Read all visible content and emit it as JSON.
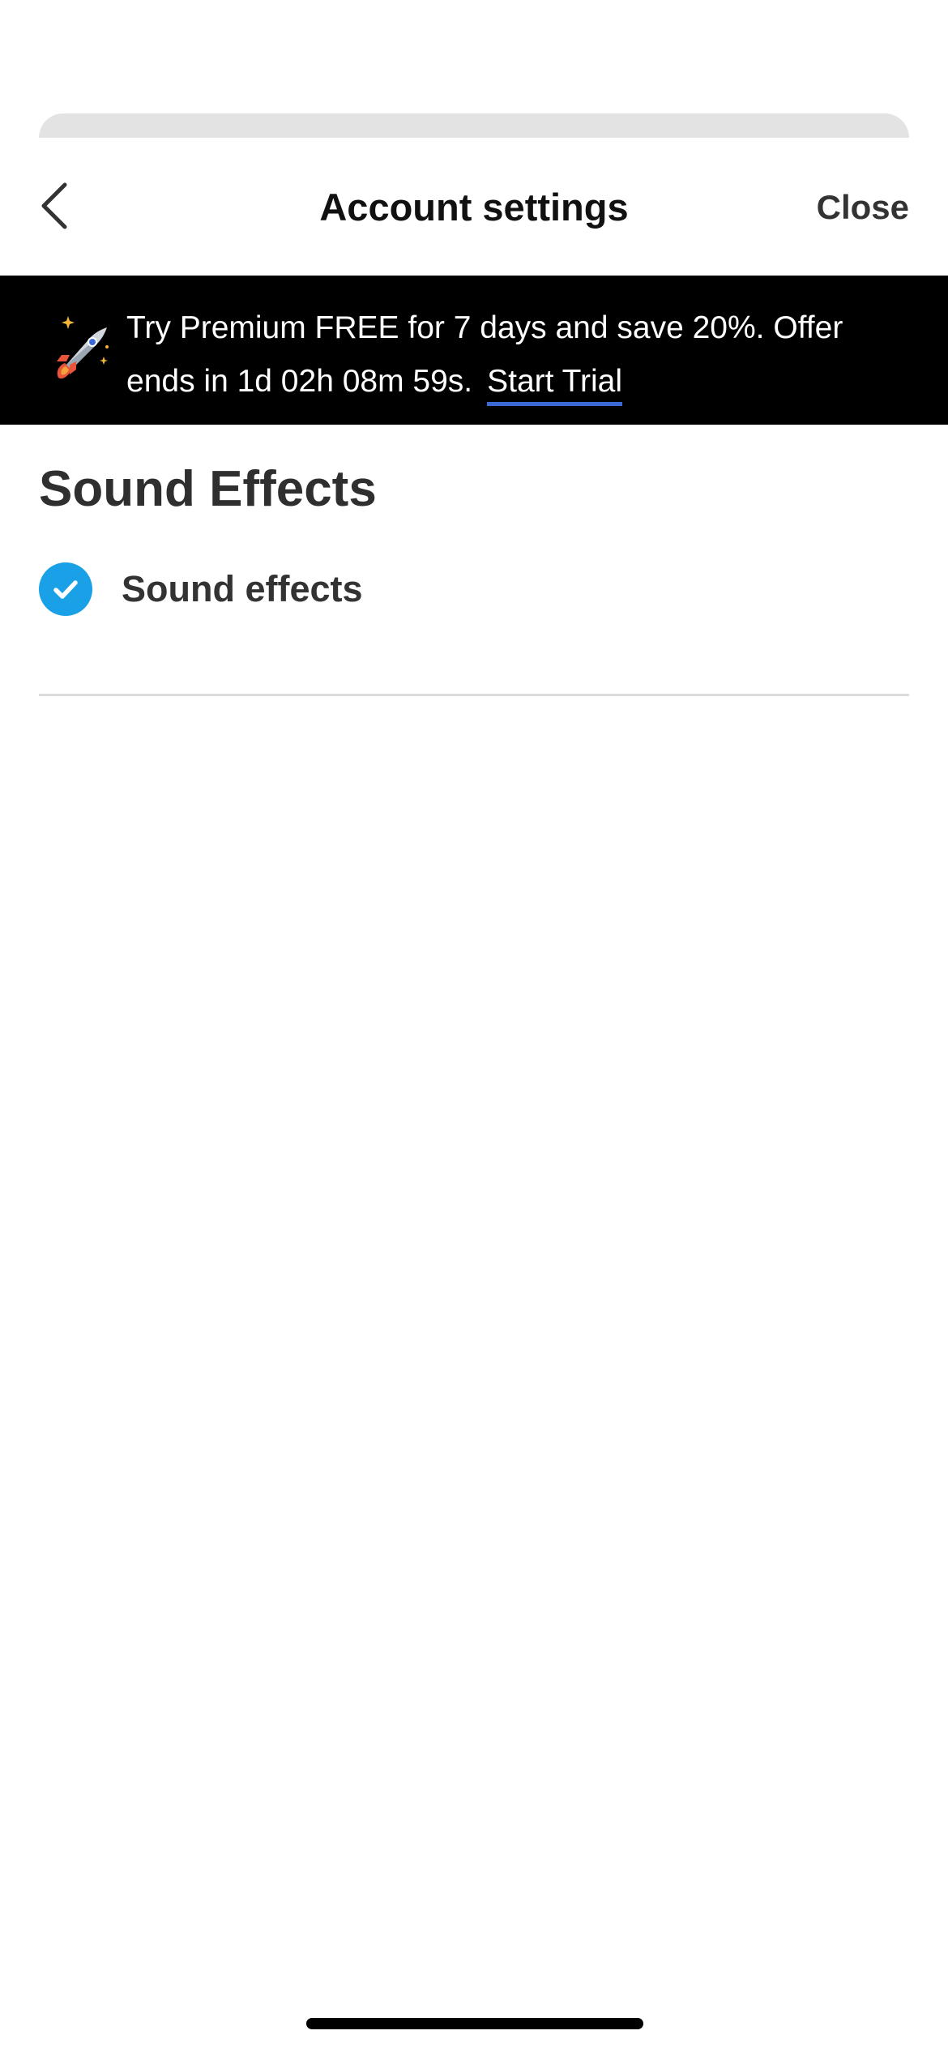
{
  "header": {
    "title": "Account settings",
    "back_icon": "chevron-left-icon",
    "close_label": "Close"
  },
  "promo": {
    "icon": "rocket-icon",
    "message": "Try Premium FREE for 7 days and save 20%. Offer ends in 1d 02h 08m 59s.",
    "cta_label": "Start Trial",
    "background_color": "#000000",
    "cta_underline_color": "#3b6ad6"
  },
  "sound_section": {
    "title": "Sound Effects",
    "options": [
      {
        "label": "Sound effects",
        "checked": true,
        "icon": "check-icon",
        "color": "#1aa0e6"
      }
    ]
  }
}
